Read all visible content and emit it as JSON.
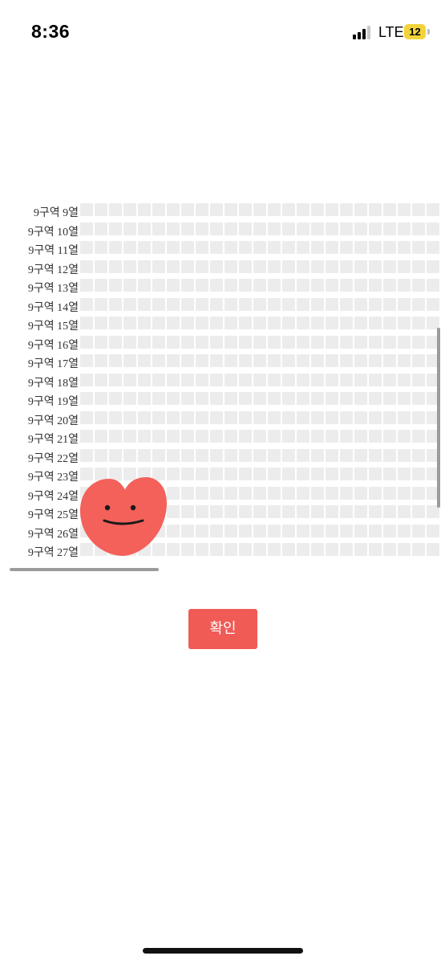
{
  "status_bar": {
    "time": "8:36",
    "network": "LTE",
    "battery": "12"
  },
  "seat_map": {
    "rows": [
      {
        "label": "9구역 9열"
      },
      {
        "label": "9구역 10열"
      },
      {
        "label": "9구역 11열"
      },
      {
        "label": "9구역 12열"
      },
      {
        "label": "9구역 13열"
      },
      {
        "label": "9구역 14열"
      },
      {
        "label": "9구역 15열"
      },
      {
        "label": "9구역 16열"
      },
      {
        "label": "9구역 17열"
      },
      {
        "label": "9구역 18열"
      },
      {
        "label": "9구역 19열"
      },
      {
        "label": "9구역 20열"
      },
      {
        "label": "9구역 21열"
      },
      {
        "label": "9구역 22열"
      },
      {
        "label": "9구역 23열"
      },
      {
        "label": "9구역 24열"
      },
      {
        "label": "9구역 25열"
      },
      {
        "label": "9구역 26열"
      },
      {
        "label": "9구역 27열"
      }
    ],
    "seat_color": "#ececec"
  },
  "confirm_button": {
    "label": "확인",
    "color": "#f05b55"
  },
  "sticker": {
    "icon": "heart-face-icon",
    "color": "#f4605a"
  }
}
